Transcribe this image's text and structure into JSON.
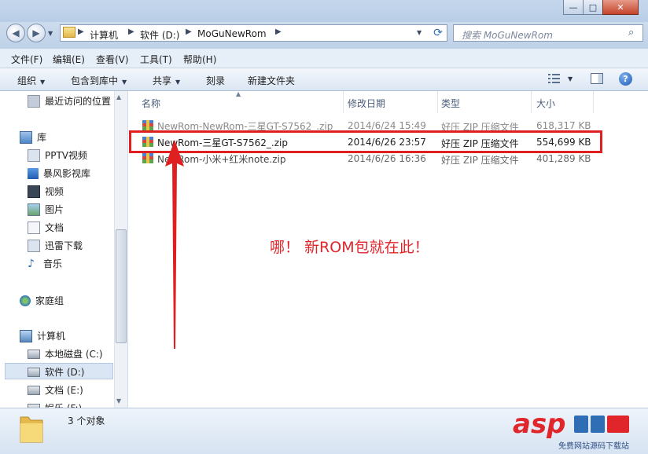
{
  "window": {
    "controls": {
      "minimize": "—",
      "maximize": "□",
      "close": "✕"
    }
  },
  "address_bar": {
    "segments": [
      "计算机",
      "软件 (D:)",
      "MoGuNewRom"
    ],
    "search_placeholder": "搜索 MoGuNewRom"
  },
  "menu": [
    "文件(F)",
    "编辑(E)",
    "查看(V)",
    "工具(T)",
    "帮助(H)"
  ],
  "toolbar": {
    "organize": "组织",
    "include_in_library": "包含到库中",
    "share": "共享",
    "burn": "刻录",
    "new_folder": "新建文件夹"
  },
  "nav": {
    "recent": "最近访问的位置",
    "library": "库",
    "library_items": [
      "PPTV视频",
      "暴风影视库",
      "视频",
      "图片",
      "文档",
      "迅雷下载",
      "音乐"
    ],
    "homegroup": "家庭组",
    "computer": "计算机",
    "drives": [
      "本地磁盘 (C:)",
      "软件 (D:)",
      "文档 (E:)",
      "娱乐 (F:)"
    ]
  },
  "columns": {
    "name": "名称",
    "modified": "修改日期",
    "type": "类型",
    "size": "大小"
  },
  "files": [
    {
      "name": "NewRom-NewRom-三星GT-S7562_.zip",
      "modified": "2014/6/24 15:49",
      "type": "好压 ZIP 压缩文件",
      "size": "618,317 KB"
    },
    {
      "name": "NewRom-三星GT-S7562_.zip",
      "modified": "2014/6/26 23:57",
      "type": "好压 ZIP 压缩文件",
      "size": "554,699 KB"
    },
    {
      "name": "NewRom-小米+红米note.zip",
      "modified": "2014/6/26 16:36",
      "type": "好压 ZIP 压缩文件",
      "size": "401,289 KB"
    }
  ],
  "status": {
    "count": "3 个对象"
  },
  "annotation": {
    "text": "哪！ 新ROM包就在此！"
  },
  "watermark": {
    "logo": "asp",
    "subtitle": "免费网站源码下载站"
  },
  "colors": {
    "annotation_red": "#e02020",
    "selection": "#dbe6f4"
  }
}
